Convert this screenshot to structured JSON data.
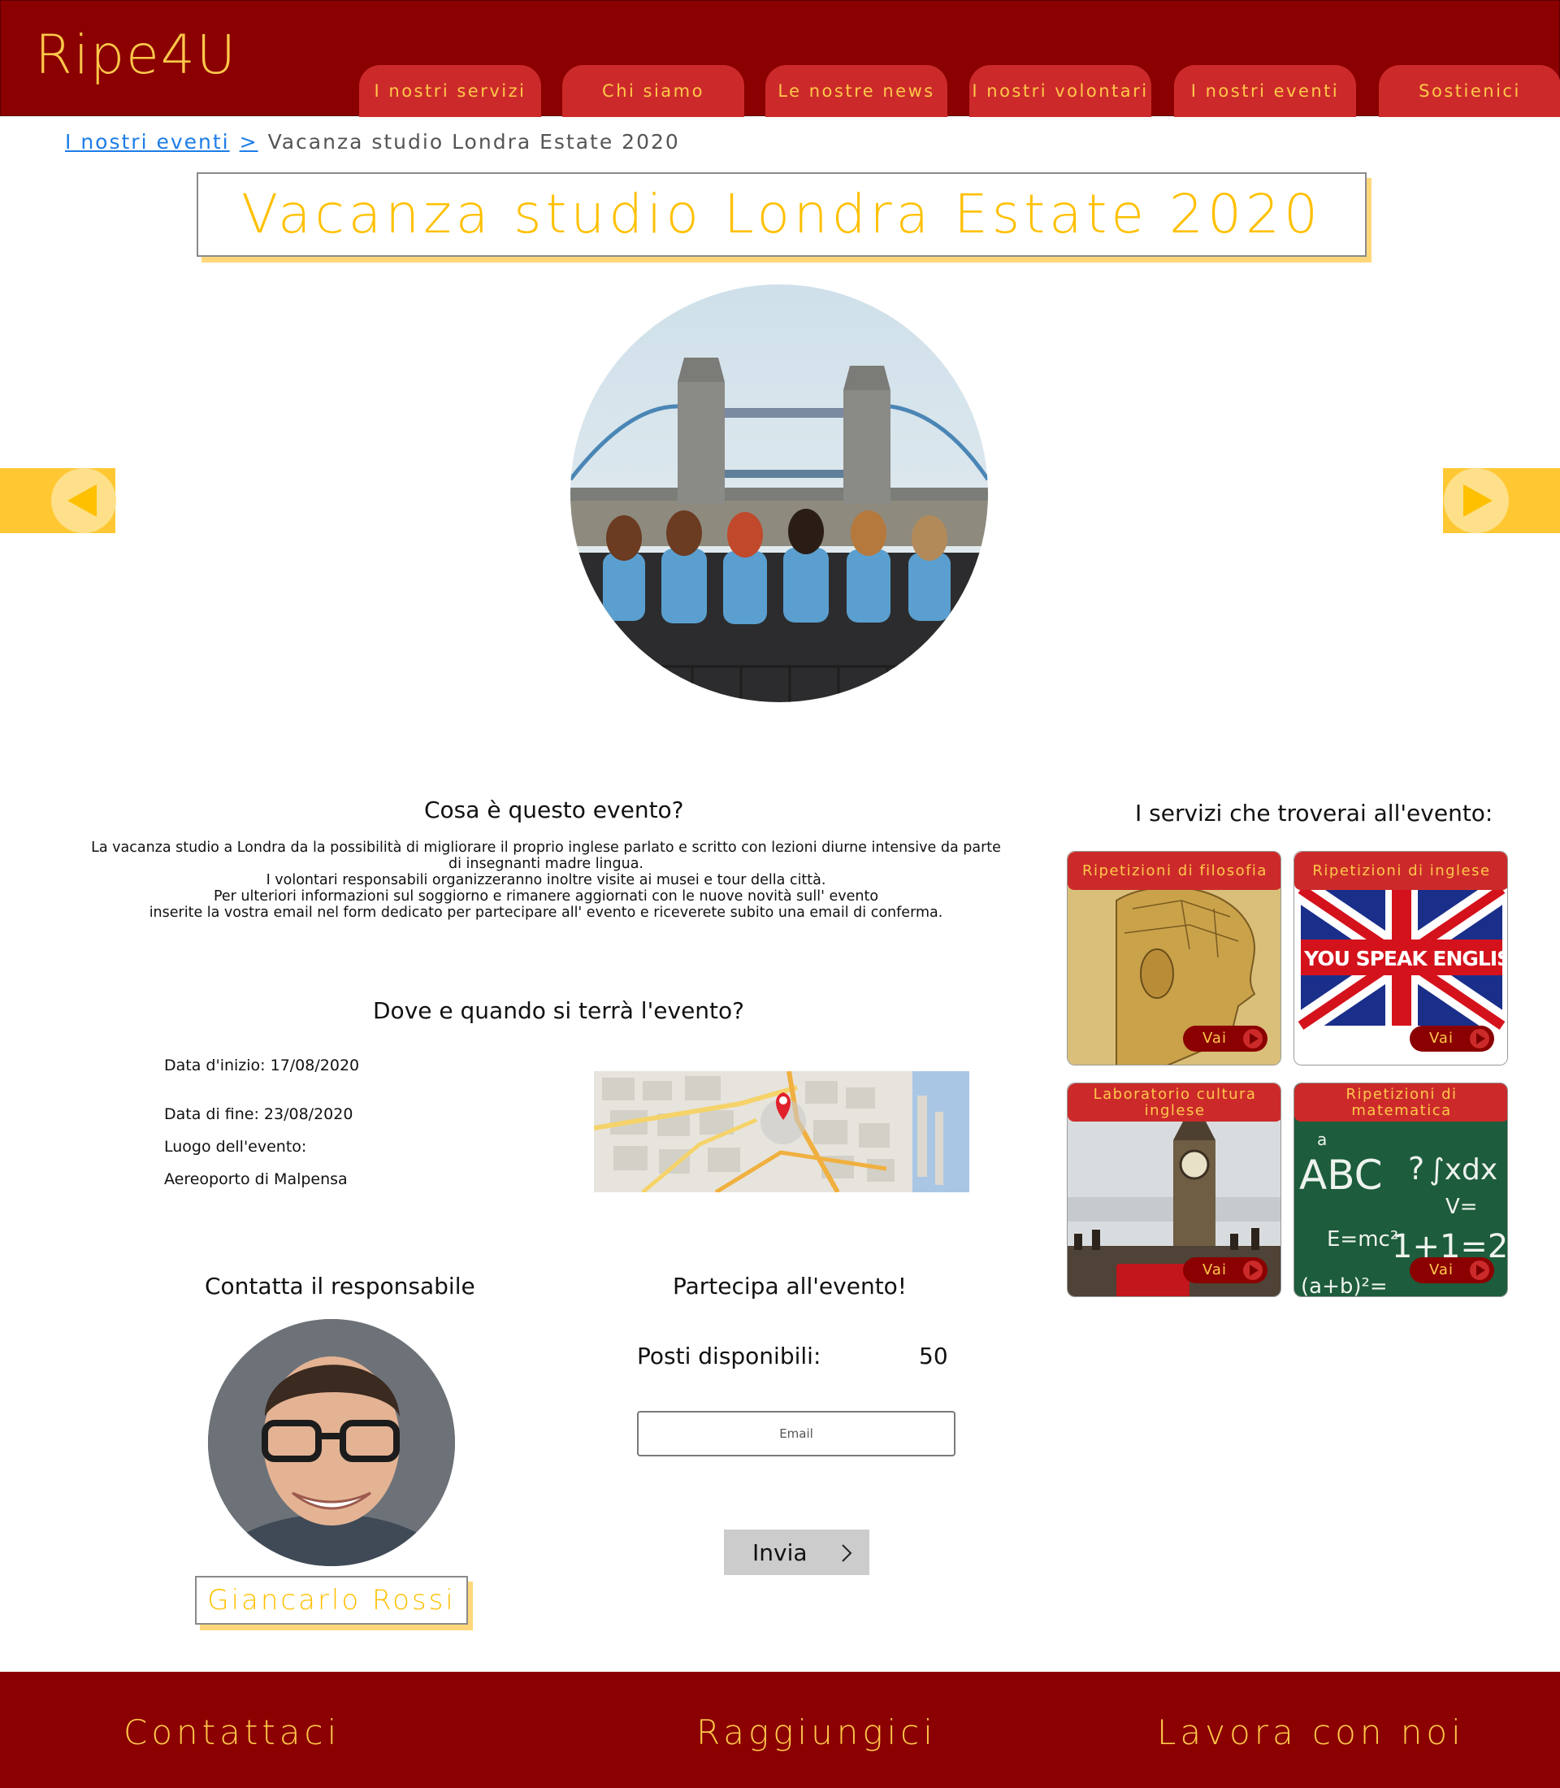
{
  "header": {
    "logo": "Ripe4U",
    "nav": [
      {
        "label": "I nostri servizi"
      },
      {
        "label": "Chi siamo"
      },
      {
        "label": "Le nostre news"
      },
      {
        "label": "I nostri volontari"
      },
      {
        "label": "I nostri eventi"
      },
      {
        "label": "Sostienici"
      }
    ]
  },
  "breadcrumb": {
    "parent": "I nostri eventi",
    "separator": ">",
    "current": "Vacanza studio Londra Estate 2020"
  },
  "event": {
    "title": "Vacanza studio Londra Estate 2020",
    "hero_alt": "Studenti davanti al Tower Bridge"
  },
  "about": {
    "heading": "Cosa è questo evento?",
    "lines": [
      "La vacanza studio a Londra da la possibilità di migliorare il proprio inglese parlato e scritto con lezioni diurne intensive da parte",
      "di insegnanti madre lingua.",
      "I volontari responsabili organizzeranno inoltre visite ai musei e tour della città.",
      "Per ulteriori informazioni sul soggiorno e rimanere aggiornati con le nuove novità sull' evento",
      "inserite la vostra email nel form dedicato per partecipare all' evento e riceverete subito una email di conferma."
    ]
  },
  "where_when": {
    "heading": "Dove e quando si terrà l'evento?",
    "start": "Data d'inizio: 17/08/2020",
    "end": "Data di fine:  23/08/2020",
    "location_label": "Luogo dell'evento:",
    "location": "Aereoporto di Malpensa"
  },
  "services": {
    "heading": "I servizi che troverai all'evento:",
    "go_label": "Vai",
    "items": [
      {
        "label": "Ripetizioni di filosofia"
      },
      {
        "label": "Ripetizioni di inglese",
        "art_text": "DO YOU SPEAK ENGLISH?"
      },
      {
        "label": "Laboratorio cultura inglese"
      },
      {
        "label": "Ripetizioni di matematica",
        "art_text": [
          "ABC",
          "?",
          "∫xdx",
          "V=",
          "E=mc²",
          "1+1=2",
          "(a+b)²=",
          "a"
        ]
      }
    ]
  },
  "contact": {
    "heading": "Contatta il responsabile",
    "name": "Giancarlo Rossi"
  },
  "join": {
    "heading": "Partecipa all'evento!",
    "seats_label": "Posti disponibili:",
    "seats_value": "50",
    "email_placeholder": "Email",
    "submit_label": "Invia"
  },
  "footer": {
    "links": [
      {
        "label": "Contattaci"
      },
      {
        "label": "Raggiungici"
      },
      {
        "label": "Lavora con noi"
      }
    ]
  },
  "colors": {
    "brand_dark_red": "#8b0000",
    "tab_red": "#cc2a2a",
    "accent_yellow": "#ffc000",
    "nav_text": "#ffc84a"
  }
}
